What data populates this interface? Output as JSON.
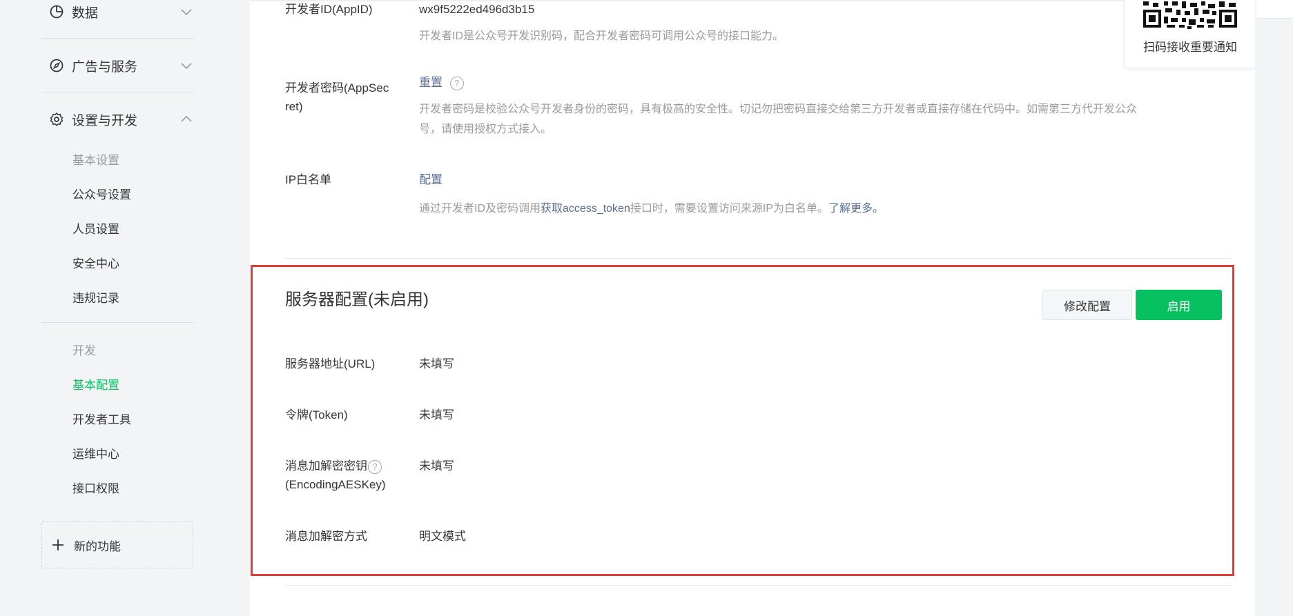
{
  "sidebar": {
    "groups": [
      {
        "label": "数据",
        "icon": "pie-chart-icon"
      },
      {
        "label": "广告与服务",
        "icon": "compass-icon"
      },
      {
        "label": "设置与开发",
        "icon": "gear-icon"
      }
    ],
    "settings_header": "基本设置",
    "settings_items": [
      "公众号设置",
      "人员设置",
      "安全中心",
      "违规记录"
    ],
    "dev_header": "开发",
    "dev_items": [
      "基本配置",
      "开发者工具",
      "运维中心",
      "接口权限"
    ],
    "active_item": "基本配置",
    "new_function": "新的功能"
  },
  "developer": {
    "appid_label": "开发者ID(AppID)",
    "appid_value": "wx9f5222ed496d3b15",
    "appid_desc": "开发者ID是公众号开发识别码，配合开发者密码可调用公众号的接口能力。",
    "secret_label_line1": "开发者密码(AppSec",
    "secret_label_line2": "ret)",
    "secret_action": "重置",
    "secret_desc_line1": "开发者密码是校验公众号开发者身份的密码，具有极高的安全性。切记勿把密码直接交给第三方开发者或直接存储在代码中。如需第三方代开发公众",
    "secret_desc_line2": "号，请使用授权方式接入。",
    "ip_label": "IP白名单",
    "ip_action": "配置",
    "ip_desc_prefix": "通过开发者ID及密码调用",
    "ip_desc_link": "获取access_token",
    "ip_desc_middle": "接口时，需要设置访问来源IP为白名单。",
    "ip_desc_more": "了解更多。"
  },
  "server": {
    "title": "服务器配置(未启用)",
    "modify_button": "修改配置",
    "enable_button": "启用",
    "url_label": "服务器地址(URL)",
    "url_value": "未填写",
    "token_label": "令牌(Token)",
    "token_value": "未填写",
    "aes_label_line1": "消息加解密密钥",
    "aes_label_line2": "(EncodingAESKey)",
    "aes_value": "未填写",
    "mode_label": "消息加解密方式",
    "mode_value": "明文模式"
  },
  "qr_popup": {
    "text": "扫码接收重要通知"
  },
  "colors": {
    "accent": "#07c160",
    "link": "#576b95",
    "highlight_border": "#e53935"
  }
}
